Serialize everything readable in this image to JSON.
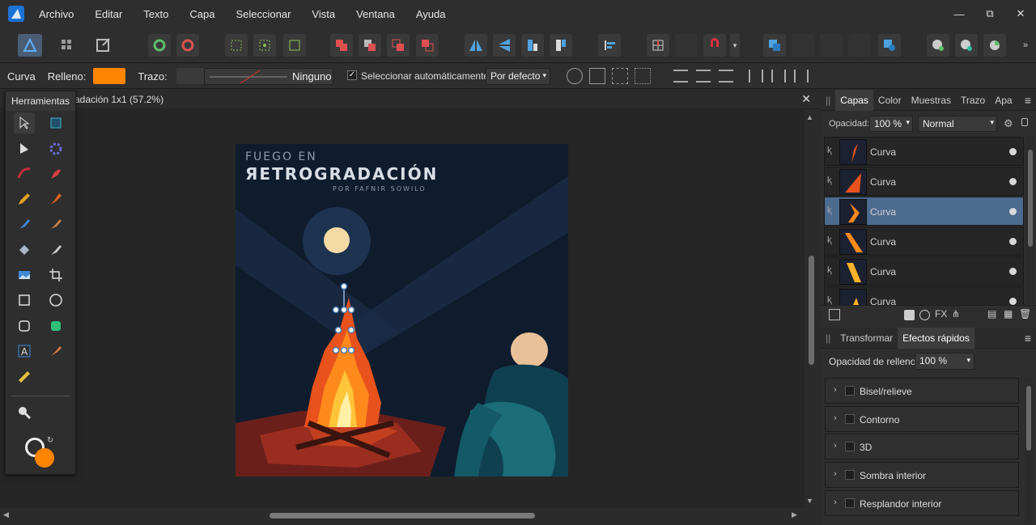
{
  "menu": [
    "Archivo",
    "Editar",
    "Texto",
    "Capa",
    "Seleccionar",
    "Vista",
    "Ventana",
    "Ayuda"
  ],
  "window_controls": [
    "—",
    "⧉",
    "✕"
  ],
  "context": {
    "tool_name": "Curva",
    "fill_label": "Relleno:",
    "fill_color": "#ff8400",
    "stroke_label": "Trazo:",
    "stroke_style": "Ninguno",
    "auto_select_label": "Seleccionar automáticamente:",
    "auto_select_value": "Por defecto"
  },
  "document": {
    "tab_title": "adación 1x1 (57.2%)"
  },
  "tools_panel": {
    "title": "Herramientas"
  },
  "artwork": {
    "title_line1": "FUEGO EN",
    "title_line2": "ЯETROGRADACIÓN",
    "byline": "POR FAFNIR SOWILO"
  },
  "layers_panel": {
    "tabs": [
      "Capas",
      "Color",
      "Muestras",
      "Trazo",
      "Apa"
    ],
    "active_tab": "Capas",
    "opacity_label": "Opacidad:",
    "opacity_value": "100 %",
    "blend_mode": "Normal",
    "layers": [
      {
        "name": "Curva",
        "selected": false
      },
      {
        "name": "Curva",
        "selected": false
      },
      {
        "name": "Curva",
        "selected": true
      },
      {
        "name": "Curva",
        "selected": false
      },
      {
        "name": "Curva",
        "selected": false
      },
      {
        "name": "Curva",
        "selected": false
      }
    ]
  },
  "fx_panel": {
    "tabs": [
      "Transformar",
      "Efectos rápidos"
    ],
    "active_tab": "Efectos rápidos",
    "fill_opacity_label": "Opacidad de relleno:",
    "fill_opacity_value": "100 %",
    "effects": [
      "Bisel/relieve",
      "Contorno",
      "3D",
      "Sombra interior",
      "Resplandor interior"
    ]
  },
  "colors": {
    "accent": "#4d6a8f",
    "fill": "#ff8400",
    "navy": "#0f1c2e"
  }
}
